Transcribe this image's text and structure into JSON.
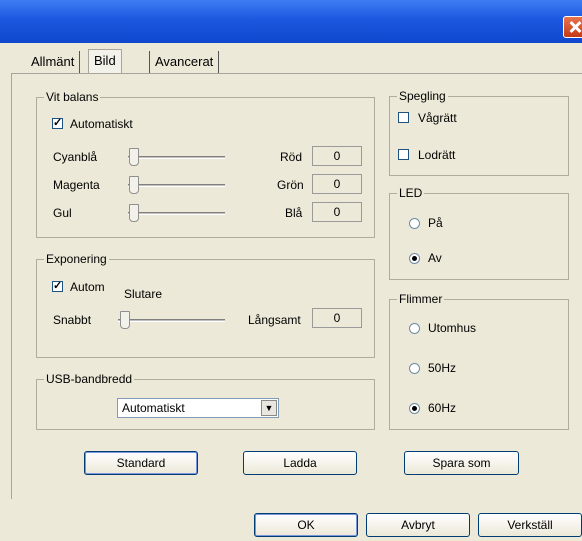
{
  "tabs": [
    "Allmänt",
    "Bild",
    "Avancerat"
  ],
  "white_balance": {
    "legend": "Vit balans",
    "auto_label": "Automatiskt",
    "auto_checked": true,
    "sliders": [
      {
        "left": "Cyanblå",
        "right": "Röd",
        "value": "0"
      },
      {
        "left": "Magenta",
        "right": "Grön",
        "value": "0"
      },
      {
        "left": "Gul",
        "right": "Blå",
        "value": "0"
      }
    ]
  },
  "exposure": {
    "legend": "Exponering",
    "auto_label": "Autom",
    "auto_checked": true,
    "shutter_label": "Slutare",
    "left": "Snabbt",
    "right": "Långsamt",
    "value": "0"
  },
  "usb": {
    "legend": "USB-bandbredd",
    "selected": "Automatiskt"
  },
  "mirror": {
    "legend": "Spegling",
    "horizontal": "Vågrätt",
    "vertical": "Lodrätt"
  },
  "led": {
    "legend": "LED",
    "on": "På",
    "off": "Av",
    "selected": "off"
  },
  "flicker": {
    "legend": "Flimmer",
    "options": [
      "Utomhus",
      "50Hz",
      "60Hz"
    ],
    "selected": "60Hz"
  },
  "buttons": {
    "standard": "Standard",
    "load": "Ladda",
    "save_as": "Spara som",
    "ok": "OK",
    "cancel": "Avbryt",
    "apply": "Verkställ"
  },
  "colors": {
    "titlebar": "#1b58df",
    "dialog_bg": "#ece9d8"
  }
}
